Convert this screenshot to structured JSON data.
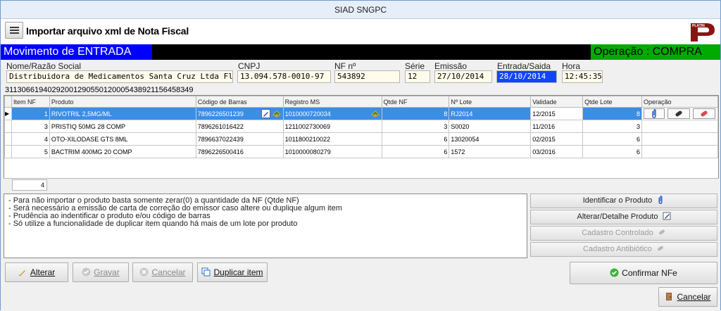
{
  "window": {
    "title": "SIAD SNGPC"
  },
  "header": {
    "title": "Importar arquivo xml de Nota Fiscal",
    "logo_text": "PLATIN"
  },
  "band": {
    "movimento": "Movimento de ENTRADA",
    "operacao": "Operação : COMPRA"
  },
  "labels": {
    "nome": "Nome/Razão Social",
    "cnpj": "CNPJ",
    "nf": "NF nº",
    "serie": "Série",
    "emissao": "Emissão",
    "entrada": "Entrada/Saida",
    "hora": "Hora"
  },
  "fields": {
    "nome": "Distribuidora de Medicamentos Santa Cruz Ltda Fl.11",
    "cnpj": "13.094.578-0010-97",
    "nf": "543892",
    "serie": "12",
    "emissao": "27/10/2014",
    "entrada": "28/10/2014",
    "hora": "12:45:35"
  },
  "access_key": "31130661940292001290550120005438921156458349",
  "grid": {
    "columns": [
      "Item NF",
      "Produto",
      "Código de Barras",
      "Registro MS",
      "Qtde NF",
      "Nº Lote",
      "Validade",
      "Qtde Lote",
      "Operação"
    ],
    "rows": [
      {
        "item": "1",
        "produto": "RIVOTRIL 2,5MG/ML",
        "barras": "7896226501239",
        "registro": "1010000720034",
        "qtde_nf": "8",
        "lote": "RJ2014",
        "validade": "12/2015",
        "qtde_lote": "8"
      },
      {
        "item": "3",
        "produto": "PRISTIQ 50MG 28 COMP",
        "barras": "7896261016422",
        "registro": "1211002730069",
        "qtde_nf": "3",
        "lote": "S0020",
        "validade": "11/2016",
        "qtde_lote": "3"
      },
      {
        "item": "4",
        "produto": "OTO-XILODASE GTS 8ML",
        "barras": "7896637022439",
        "registro": "1011800210022",
        "qtde_nf": "6",
        "lote": "13020054",
        "validade": "02/2015",
        "qtde_lote": "6"
      },
      {
        "item": "5",
        "produto": "BACTRIM 400MG 20 COMP",
        "barras": "7896226500416",
        "registro": "1010000080279",
        "qtde_nf": "6",
        "lote": "1572",
        "validade": "03/2016",
        "qtde_lote": "6"
      }
    ],
    "count": "4"
  },
  "info_lines": [
    "- Para não importar o produto basta somente zerar(0) a quantidade da NF (Qtde NF)",
    "- Será necessário a emissão de carta de correção do emissor caso altere ou duplique algum item",
    "- Prudência ao indentificar o produto e/ou código de barras",
    "- Só utilize a funcionalidade de duplicar item quando há mais de um lote por produto"
  ],
  "side_buttons": {
    "identificar": "Identificar o Produto",
    "alterar_detalhe": "Alterar/Detalhe Produto",
    "controlado": "Cadastro Controlado",
    "antibiotico": "Cadastro Antibiótico"
  },
  "buttons": {
    "alterar": "Alterar",
    "gravar": "Gravar",
    "cancelar_dis": "Cancelar",
    "duplicar": "Duplicar item",
    "confirmar": "Confirmar NFe",
    "cancelar": "Cancelar"
  },
  "colors": {
    "band_blue": "#0000ff",
    "band_green": "#00aa00",
    "selection": "#3a8ee6"
  }
}
